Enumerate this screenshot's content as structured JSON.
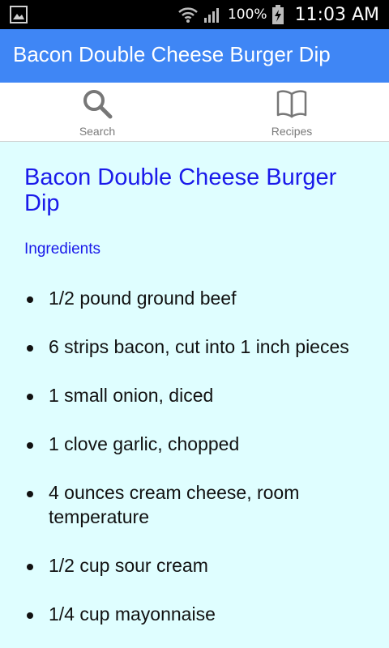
{
  "status_bar": {
    "battery_percent": "100%",
    "time": "11:03 AM",
    "icons": [
      "gallery-icon",
      "wifi-icon",
      "signal-icon",
      "battery-charging-icon"
    ]
  },
  "app_bar": {
    "title": "Bacon Double Cheese Burger Dip",
    "color": "#3f86f5"
  },
  "tabs": [
    {
      "label": "Search",
      "icon": "search-icon"
    },
    {
      "label": "Recipes",
      "icon": "book-icon"
    }
  ],
  "recipe": {
    "title": "Bacon Double Cheese Burger Dip",
    "section_heading": "Ingredients",
    "ingredients": [
      "1/2 pound ground beef",
      "6 strips bacon, cut into 1 inch pieces",
      "1 small onion, diced",
      "1 clove garlic, chopped",
      "4 ounces cream cheese, room temperature",
      "1/2 cup sour cream",
      "1/4 cup mayonnaise"
    ]
  },
  "colors": {
    "content_background": "#dffeff",
    "heading_blue": "#1a1aea"
  }
}
